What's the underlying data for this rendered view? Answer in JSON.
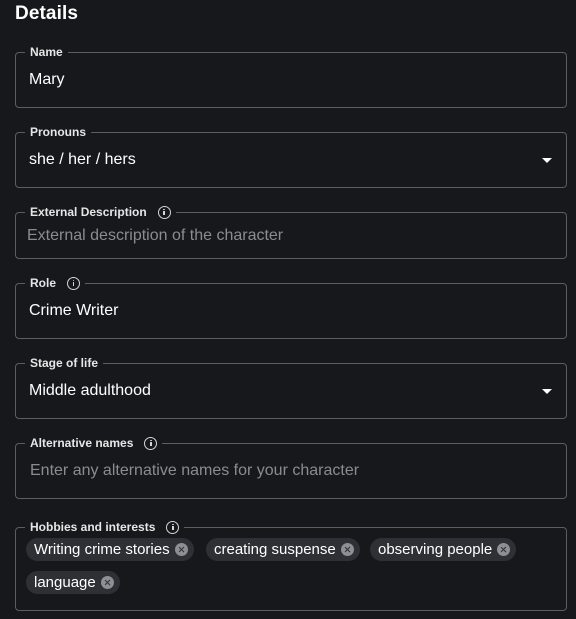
{
  "section": {
    "title": "Details"
  },
  "fields": {
    "name": {
      "label": "Name",
      "value": "Mary"
    },
    "pronouns": {
      "label": "Pronouns",
      "value": "she / her / hers"
    },
    "external_description": {
      "label": "External Description",
      "placeholder": "External description of the character"
    },
    "role": {
      "label": "Role",
      "value": "Crime Writer"
    },
    "stage_of_life": {
      "label": "Stage of life",
      "value": "Middle adulthood"
    },
    "alternative_names": {
      "label": "Alternative names",
      "placeholder": "Enter any alternative names for your character"
    },
    "hobbies": {
      "label": "Hobbies and interests",
      "chips": [
        "Writing crime stories",
        "creating suspense",
        "observing people",
        "language"
      ]
    }
  },
  "colors": {
    "background": "#17181c",
    "border": "#5b5d63",
    "chip": "#2e3035",
    "placeholder": "#8a8c91"
  },
  "icons": {
    "info": "info-icon",
    "dropdown": "chevron-down-icon",
    "chip_remove": "close-circle-icon"
  }
}
